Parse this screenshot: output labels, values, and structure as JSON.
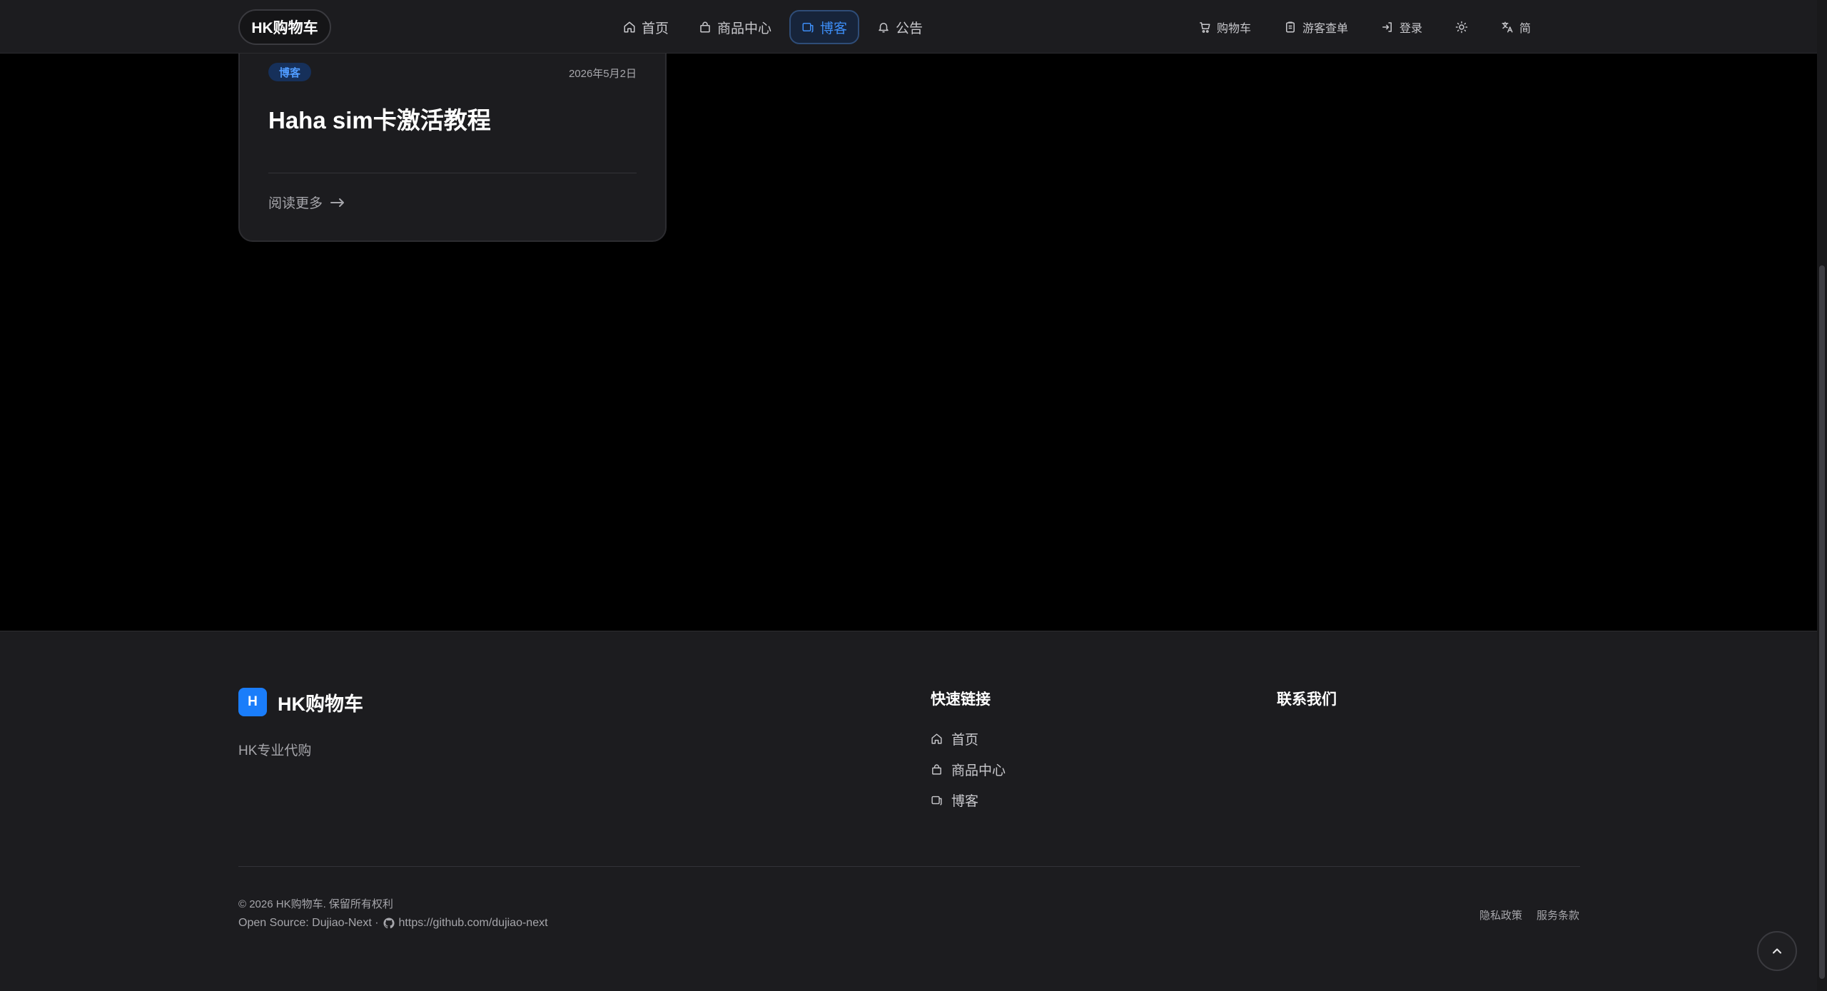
{
  "header": {
    "brand": "HK购物车",
    "nav": [
      {
        "label": "首页",
        "icon": "home-icon",
        "active": false
      },
      {
        "label": "商品中心",
        "icon": "bag-icon",
        "active": false
      },
      {
        "label": "博客",
        "icon": "blog-icon",
        "active": true
      },
      {
        "label": "公告",
        "icon": "bell-icon",
        "active": false
      }
    ],
    "actions": {
      "cart": "购物车",
      "guest_orders": "游客查单",
      "login": "登录",
      "theme_icon": "sun-icon",
      "language": "简"
    },
    "accent_color": "#3d8df5"
  },
  "blog_post": {
    "badge": "博客",
    "date": "2026年5月2日",
    "title": "Haha sim卡激活教程",
    "read_more": "阅读更多"
  },
  "footer": {
    "logo_letter": "H",
    "brand": "HK购物车",
    "tagline": "HK专业代购",
    "quick_links_heading": "快速链接",
    "quick_links": [
      {
        "label": "首页",
        "icon": "home-icon"
      },
      {
        "label": "商品中心",
        "icon": "bag-icon"
      },
      {
        "label": "博客",
        "icon": "blog-icon"
      }
    ],
    "contact_heading": "联系我们",
    "copyright": "© 2026 HK购物车. 保留所有权利",
    "open_source_prefix": "Open Source: Dujiao-Next ·",
    "github_url": "https://github.com/dujiao-next",
    "privacy": "隐私政策",
    "terms": "服务条款",
    "logo_color": "#1a7dfa"
  }
}
